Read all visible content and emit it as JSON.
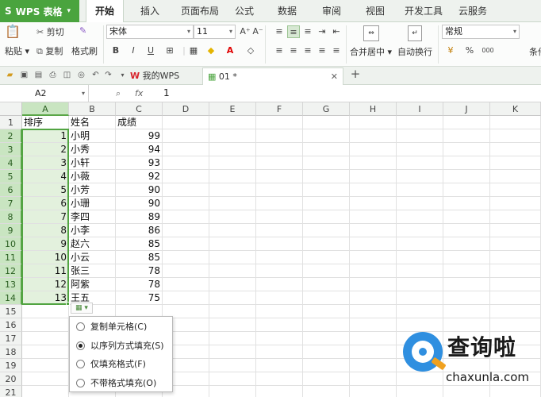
{
  "app": {
    "title": "WPS 表格",
    "logo": "S",
    "accent": "#4aa43e"
  },
  "menu": {
    "tabs": [
      "开始",
      "插入",
      "页面布局",
      "公式",
      "数据",
      "审阅",
      "视图",
      "开发工具",
      "云服务"
    ],
    "active": "开始"
  },
  "ribbon": {
    "cut": "剪切",
    "paste": "粘贴",
    "copy": "复制",
    "format_painter": "格式刷",
    "font_name": "宋体",
    "font_size": "11",
    "merge_center": "合并居中",
    "wrap": "自动换行",
    "number_format": "常规",
    "cond": "条件",
    "bold": "B",
    "italic": "I",
    "underline": "U",
    "font_grow": "A⁺",
    "font_shrink": "A⁻",
    "percent": "%",
    "thousands": "000"
  },
  "doc_tabs": [
    {
      "label": "我的WPS"
    },
    {
      "label": "01 *"
    }
  ],
  "formula_bar": {
    "cell_ref": "A2",
    "fx_label": "fx",
    "value": "1"
  },
  "columns": [
    "A",
    "B",
    "C",
    "D",
    "E",
    "F",
    "G",
    "H",
    "I",
    "J",
    "K"
  ],
  "rows": [
    "1",
    "2",
    "3",
    "4",
    "5",
    "6",
    "7",
    "8",
    "9",
    "10",
    "11",
    "12",
    "13",
    "14",
    "15",
    "16",
    "17",
    "18",
    "19",
    "20",
    "21"
  ],
  "sheet": {
    "headers": [
      "排序",
      "姓名",
      "成绩"
    ],
    "data": [
      [
        "1",
        "小明",
        "99"
      ],
      [
        "2",
        "小秀",
        "94"
      ],
      [
        "3",
        "小轩",
        "93"
      ],
      [
        "4",
        "小薇",
        "92"
      ],
      [
        "5",
        "小芳",
        "90"
      ],
      [
        "6",
        "小珊",
        "90"
      ],
      [
        "7",
        "李四",
        "89"
      ],
      [
        "8",
        "小李",
        "86"
      ],
      [
        "9",
        "赵六",
        "85"
      ],
      [
        "10",
        "小云",
        "85"
      ],
      [
        "11",
        "张三",
        "78"
      ],
      [
        "12",
        "阿紫",
        "78"
      ],
      [
        "13",
        "王五",
        "75"
      ]
    ]
  },
  "autofill_menu": {
    "options": [
      {
        "label": "复制单元格(C)",
        "selected": false
      },
      {
        "label": "以序列方式填充(S)",
        "selected": true
      },
      {
        "label": "仅填充格式(F)",
        "selected": false
      },
      {
        "label": "不带格式填充(O)",
        "selected": false
      }
    ]
  },
  "watermark": {
    "cn": "查询啦",
    "url": "chaxunla.com"
  },
  "icons": [
    "scissors-icon",
    "copy-icon",
    "brush-icon",
    "undo-icon",
    "redo-icon",
    "save-icon",
    "print-icon",
    "plus-icon",
    "close-icon"
  ]
}
